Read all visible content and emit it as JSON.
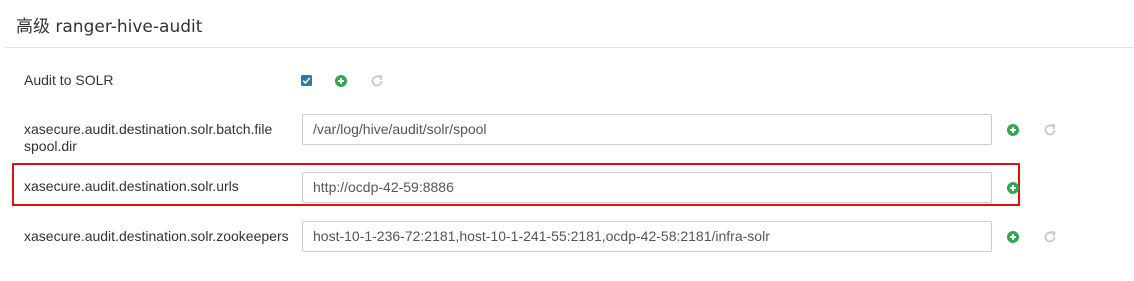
{
  "section": {
    "title": "高级 ranger-hive-audit"
  },
  "rows": [
    {
      "label": "Audit to SOLR",
      "type": "checkbox",
      "checked": true
    },
    {
      "label": "xasecure.audit.destination.solr.batch.filespool.dir",
      "value": "/var/log/hive/audit/solr/spool"
    },
    {
      "label": "xasecure.audit.destination.solr.urls",
      "value": "http://ocdp-42-59:8886",
      "highlighted": true
    },
    {
      "label": "xasecure.audit.destination.solr.zookeepers",
      "value": "host-10-1-236-72:2181,host-10-1-241-55:2181,ocdp-42-58:2181/infra-solr"
    }
  ],
  "icons": {
    "add": "plus-circle-icon",
    "undo": "undo-icon",
    "checkbox": "checkbox-icon"
  },
  "colors": {
    "accent_checkbox": "#2a7ab0",
    "add_icon": "#2fa84f",
    "undo_icon_disabled": "#c8c8c8",
    "highlight_border": "#e01010"
  }
}
